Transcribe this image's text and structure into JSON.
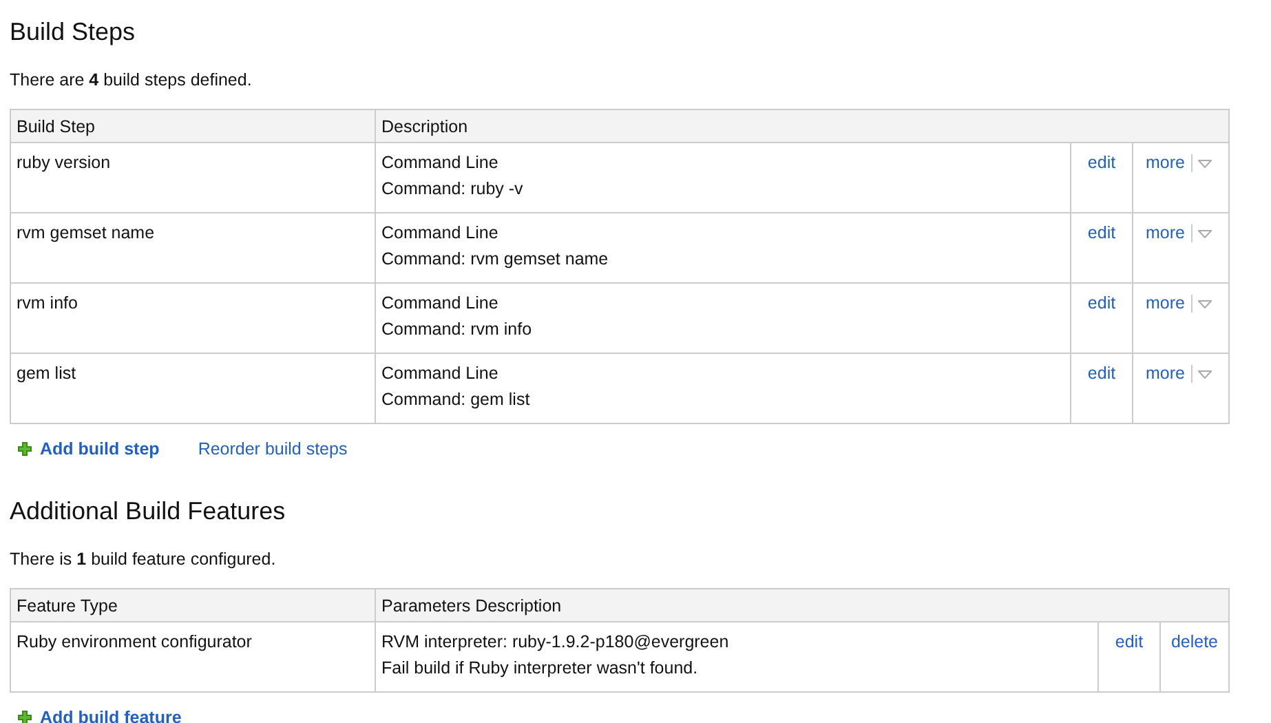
{
  "build_steps": {
    "title": "Build Steps",
    "summary": "There are **4** build steps defined.",
    "columns": [
      "Build Step",
      "Description"
    ],
    "rows": [
      {
        "name": "ruby version",
        "description": [
          "Command Line",
          "Command: ruby -v"
        ],
        "edit": "edit",
        "more": "more"
      },
      {
        "name": "rvm gemset name",
        "description": [
          "Command Line",
          "Command: rvm gemset name"
        ],
        "edit": "edit",
        "more": "more"
      },
      {
        "name": "rvm info",
        "description": [
          "Command Line",
          "Command: rvm info"
        ],
        "edit": "edit",
        "more": "more"
      },
      {
        "name": "gem list",
        "description": [
          "Command Line",
          "Command: gem list"
        ],
        "edit": "edit",
        "more": "more"
      }
    ],
    "add_link": "Add build step",
    "reorder_link": "Reorder build steps"
  },
  "build_features": {
    "title": "Additional Build Features",
    "summary": "There is **1** build feature configured.",
    "columns": [
      "Feature Type",
      "Parameters Description"
    ],
    "rows": [
      {
        "name": "Ruby environment configurator",
        "description": [
          "RVM interpreter: ruby-1.9.2-p180@evergreen",
          "Fail build if Ruby interpreter wasn't found."
        ],
        "edit": "edit",
        "delete": "delete"
      }
    ],
    "add_link": "Add build feature"
  }
}
